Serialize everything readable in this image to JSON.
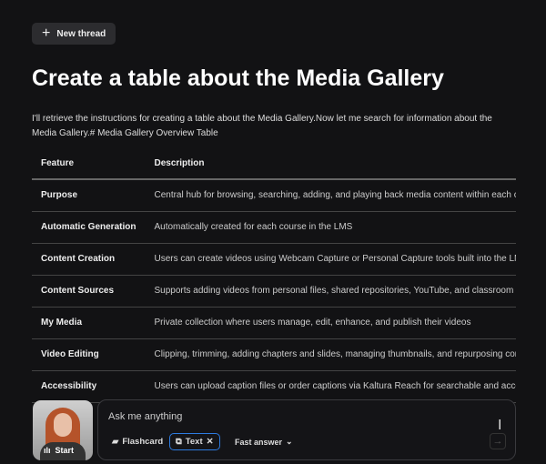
{
  "header": {
    "new_thread_label": "New thread"
  },
  "title": "Create a table about the Media Gallery",
  "intro": "I'll retrieve the instructions for creating a table about the Media Gallery.Now let me search for information about the Media Gallery.# Media Gallery Overview Table",
  "table": {
    "headers": [
      "Feature",
      "Description"
    ],
    "rows": [
      [
        "Purpose",
        "Central hub for browsing, searching, adding, and playing back media content within each course"
      ],
      [
        "Automatic Generation",
        "Automatically created for each course in the LMS"
      ],
      [
        "Content Creation",
        "Users can create videos using Webcam Capture or Personal Capture tools built into the LMS"
      ],
      [
        "Content Sources",
        "Supports adding videos from personal files, shared repositories, YouTube, and classroom recordings"
      ],
      [
        "My Media",
        "Private collection where users manage, edit, enhance, and publish their videos"
      ],
      [
        "Video Editing",
        "Clipping, trimming, adding chapters and slides, managing thumbnails, and repurposing content"
      ],
      [
        "Accessibility",
        "Users can upload caption files or order captions via Kaltura Reach for searchable and accessible content"
      ]
    ]
  },
  "avatar": {
    "start_label": "Start"
  },
  "composer": {
    "placeholder": "Ask me anything",
    "flashcard_label": "Flashcard",
    "text_label": "Text",
    "fast_answer_label": "Fast answer"
  },
  "colors": {
    "background": "#121214",
    "accent": "#2d7be0"
  }
}
